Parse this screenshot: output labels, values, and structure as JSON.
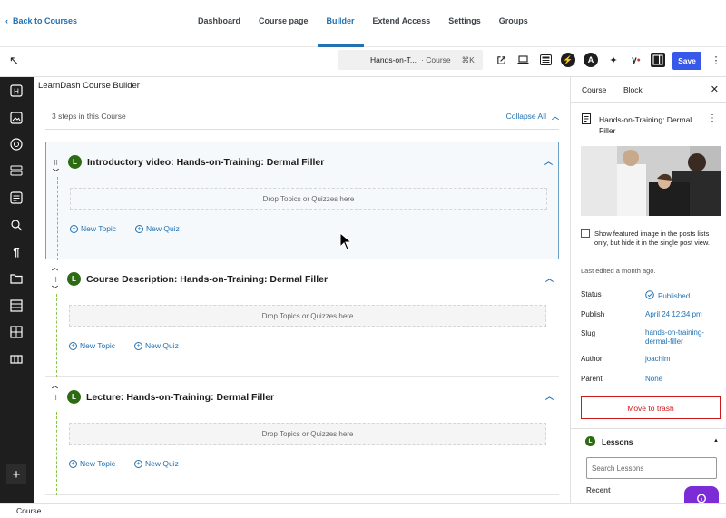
{
  "nav": {
    "back_label": "Back to Courses",
    "tabs": [
      {
        "label": "Dashboard",
        "active": false
      },
      {
        "label": "Course page",
        "active": false
      },
      {
        "label": "Builder",
        "active": true
      },
      {
        "label": "Extend Access",
        "active": false
      },
      {
        "label": "Settings",
        "active": false
      },
      {
        "label": "Groups",
        "active": false
      }
    ]
  },
  "toolbar": {
    "command_title": "Hands-on-T...",
    "command_type": "· Course",
    "command_shortcut": "⌘K",
    "save_label": "Save"
  },
  "builder": {
    "title": "LearnDash Course Builder",
    "steps_text": "3 steps in this Course",
    "collapse_label": "Collapse All",
    "lessons": [
      {
        "badge": "L",
        "title": "Introductory video: Hands-on-Training: Dermal Filler",
        "drop_text": "Drop Topics or Quizzes here",
        "new_topic": "New Topic",
        "new_quiz": "New Quiz"
      },
      {
        "badge": "L",
        "title": "Course Description: Hands-on-Training: Dermal Filler",
        "drop_text": "Drop Topics or Quizzes here",
        "new_topic": "New Topic",
        "new_quiz": "New Quiz"
      },
      {
        "badge": "L",
        "title": "Lecture: Hands-on-Training: Dermal Filler",
        "drop_text": "Drop Topics or Quizzes here",
        "new_topic": "New Topic",
        "new_quiz": "New Quiz"
      }
    ]
  },
  "panel": {
    "tab_course": "Course",
    "tab_block": "Block",
    "post_title": "Hands-on-Training: Dermal Filler",
    "featured_checkbox": "Show featured image in the posts lists only, but hide it in the single post view.",
    "last_edited": "Last edited a month ago.",
    "status_label": "Status",
    "status_value": "Published",
    "publish_label": "Publish",
    "publish_value": "April 24 12:34 pm",
    "slug_label": "Slug",
    "slug_value": "hands-on-training-dermal-filler",
    "author_label": "Author",
    "author_value": "joachim",
    "parent_label": "Parent",
    "parent_value": "None",
    "trash_label": "Move to trash",
    "lessons_title": "Lessons",
    "lessons_badge": "L",
    "search_placeholder": "Search Lessons",
    "recent_label": "Recent"
  },
  "statusbar": {
    "breadcrumb": "Course"
  },
  "colors": {
    "accent": "#2271b1",
    "save": "#3858e9",
    "lesson_badge": "#2d6a14",
    "trash": "#cc1818",
    "help": "#7b2cd6"
  }
}
